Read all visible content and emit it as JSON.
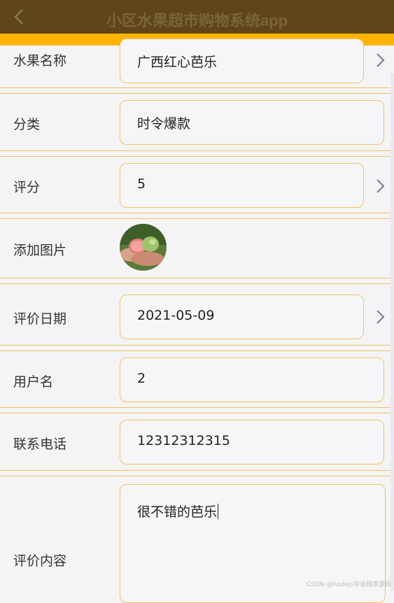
{
  "header": {
    "title": "小区水果超市购物系统app",
    "back_icon": "chevron-left-icon"
  },
  "form": {
    "fruit_name": {
      "label": "水果名称",
      "value": "广西红心芭乐"
    },
    "category": {
      "label": "分类",
      "value": "时令爆款"
    },
    "rating": {
      "label": "评分",
      "value": "5"
    },
    "image": {
      "label": "添加图片"
    },
    "review_date": {
      "label": "评价日期",
      "value": "2021-05-09"
    },
    "username": {
      "label": "用户名",
      "value": "2"
    },
    "phone": {
      "label": "联系电话",
      "value": "12312312315"
    },
    "content": {
      "label": "评价内容",
      "value": "很不错的芭乐"
    }
  },
  "watermark": "CSDN @nodejs毕设程序源码",
  "colors": {
    "header_bg": "#5e4619",
    "accent": "#ffb300",
    "border": "#f3c15f"
  }
}
